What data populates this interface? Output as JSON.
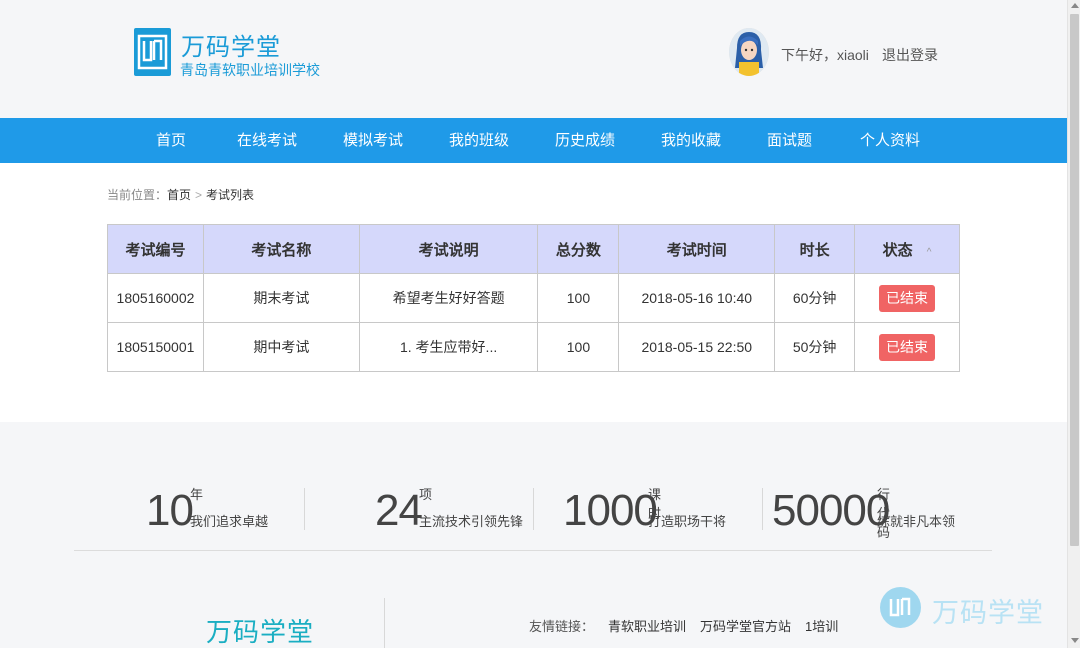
{
  "header": {
    "logo_title": "万码学堂",
    "logo_sub": "青岛青软职业培训学校",
    "greeting": "下午好，xiaoli",
    "logout": "退出登录"
  },
  "nav": {
    "items": [
      "首页",
      "在线考试",
      "模拟考试",
      "我的班级",
      "历史成绩",
      "我的收藏",
      "面试题",
      "个人资料"
    ]
  },
  "breadcrumb": {
    "prefix": "当前位置：",
    "home": "首页",
    "separator": ">",
    "current": "考试列表"
  },
  "table": {
    "columns": [
      "考试编号",
      "考试名称",
      "考试说明",
      "总分数",
      "考试时间",
      "时长",
      "状态"
    ],
    "sort_indicator": "^",
    "rows": [
      [
        "1805160002",
        "期末考试",
        "希望考生好好答题",
        "100",
        "2018-05-16 10:40",
        "60分钟",
        "已结束"
      ],
      [
        "1805150001",
        "期中考试",
        "1. 考生应带好...",
        "100",
        "2018-05-15 22:50",
        "50分钟",
        "已结束"
      ]
    ]
  },
  "stats": [
    {
      "num": "10",
      "unit": "年",
      "desc": "我们追求卓越"
    },
    {
      "num": "24",
      "unit": "项",
      "desc": "主流技术引领先锋"
    },
    {
      "num": "1000",
      "unit": "课时",
      "desc": "打造职场干将"
    },
    {
      "num": "50000",
      "unit": "行代码",
      "desc": "练就非凡本领"
    }
  ],
  "footer": {
    "brand": "万码学堂",
    "links_label": "友情链接：",
    "links": [
      "青软职业培训",
      "万码学堂官方站",
      "1培训"
    ]
  },
  "watermark": {
    "text": "万码学堂"
  },
  "colors": {
    "nav_bg": "#1f9ae8",
    "brand": "#1a9bd7",
    "table_header": "#d5d8fb",
    "status_ended": "#f06464"
  }
}
